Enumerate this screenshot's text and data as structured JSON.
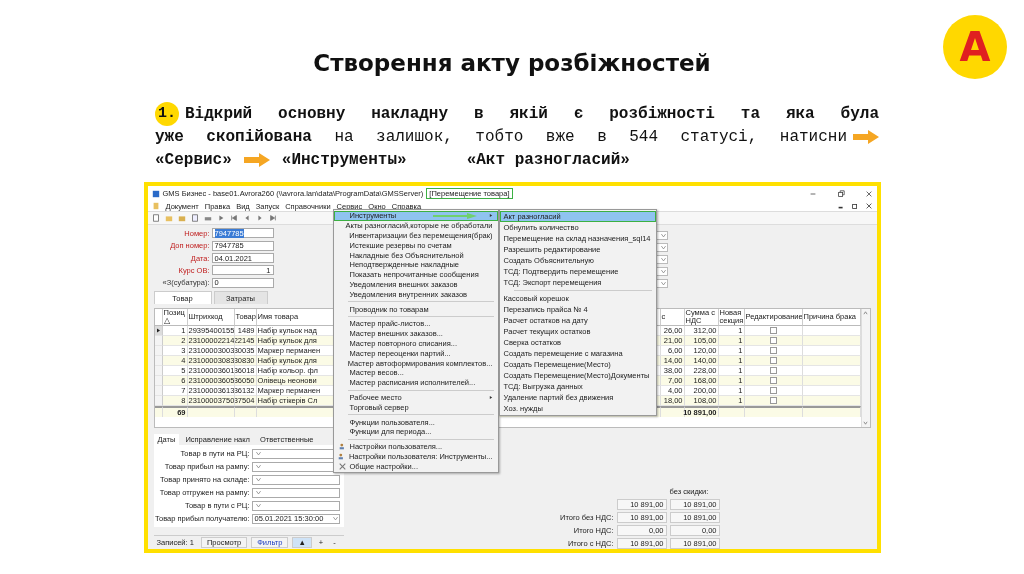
{
  "slide": {
    "title": "Створення акту розбіжностей",
    "badge": "A",
    "step": {
      "number": "1.",
      "lines": [
        {
          "text": "Відкрий основну накладну в якій є розбіжності та яка була",
          "bold": true
        },
        {
          "text": "**уже скопійована** на залишок, тобто вже в 544 статусі,  натисни",
          "bold": false
        }
      ],
      "path": [
        "«Сервис»",
        "«Инструменты»",
        "«Акт разногласий»"
      ]
    }
  },
  "window": {
    "title": "GMS Бизнес - base01.Avrora260 (\\\\avrora.lan\\data\\ProgramData\\GMSServer)",
    "document": "[Перемещение товара]",
    "menu": [
      "Документ",
      "Правка",
      "Вид",
      "Запуск",
      "Справочники",
      "Сервис",
      "Окно",
      "Справка"
    ],
    "fields": [
      {
        "label": "Номер:",
        "value": "7947785",
        "selected": true
      },
      {
        "label": "Доп номер:",
        "value": "7947785",
        "selected": false
      },
      {
        "label": "Дата:",
        "value": "04.01.2021",
        "selected": false
      },
      {
        "label": "Курс ОВ:",
        "value": "1",
        "selected": false
      },
      {
        "label": "«З(субатура):",
        "value": "0",
        "selected": false
      }
    ],
    "tabs": [
      {
        "label": "Товар",
        "selected": true
      },
      {
        "label": "Затраты",
        "selected": false
      }
    ],
    "table": {
      "columns": [
        "Позиц △",
        "Штрихкод",
        "Товар",
        "Имя товара",
        "с",
        "Сумма с НДС",
        "Новая секция",
        "Редактирование",
        "Причина брака"
      ],
      "rows": [
        {
          "selected": true,
          "cells": [
            "1",
            "29395400155",
            "1489",
            "Набір кульок над",
            "26,00",
            "312,00",
            "1"
          ],
          "editing": false
        },
        {
          "selected": false,
          "cells": [
            "2",
            "23100002214",
            "22145",
            "Набір кульок для",
            "21,00",
            "105,00",
            "1"
          ],
          "editing": false
        },
        {
          "selected": false,
          "cells": [
            "3",
            "23100003003",
            "30035",
            "Маркер перманен",
            "6,00",
            "120,00",
            "1"
          ],
          "editing": false
        },
        {
          "selected": false,
          "cells": [
            "4",
            "23100003083",
            "30830",
            "Набір кульок для",
            "14,00",
            "140,00",
            "1"
          ],
          "editing": false
        },
        {
          "selected": false,
          "cells": [
            "5",
            "23100003601",
            "36018",
            "Набір кольор. фл",
            "38,00",
            "228,00",
            "1"
          ],
          "editing": false
        },
        {
          "selected": false,
          "cells": [
            "6",
            "23100003605",
            "36050",
            "Олівець неонови",
            "7,00",
            "168,00",
            "1"
          ],
          "editing": false
        },
        {
          "selected": false,
          "cells": [
            "7",
            "23100003613",
            "36132",
            "Маркер перманен",
            "4,00",
            "200,00",
            "1"
          ],
          "editing": false
        },
        {
          "selected": false,
          "cells": [
            "8",
            "23100003750",
            "37504",
            "Набір стікерів Сл",
            "18,00",
            "108,00",
            "1"
          ],
          "editing": false
        }
      ],
      "total": {
        "count": "69",
        "sum": "10 891,00"
      }
    },
    "bottom_tabs": [
      {
        "label": "Даты",
        "selected": true
      },
      {
        "label": "Исправление накл",
        "selected": false
      },
      {
        "label": "Ответственные",
        "selected": false
      }
    ],
    "dates": [
      {
        "label": "Товар в пути на РЦ:"
      },
      {
        "label": "Товар прибыл на рампу:"
      },
      {
        "label": "Товар принято на складе:"
      },
      {
        "label": "Товар отгружен на рампу:"
      },
      {
        "label": "Товар в пути с РЦ:"
      },
      {
        "label": "Товар прибыл получателю:",
        "value": "05.01.2021 15:30:00"
      }
    ],
    "totals": {
      "header": "без скидки:",
      "rows": [
        {
          "values": [
            "10 891,00",
            "10 891,00"
          ]
        },
        {
          "label": "Итого без НДС:",
          "values": [
            "10 891,00",
            "10 891,00"
          ]
        },
        {
          "label": "Итого НДС:",
          "values": [
            "0,00",
            "0,00"
          ]
        },
        {
          "label": "Итого с НДС:",
          "values": [
            "10 891,00",
            "10 891,00"
          ]
        }
      ]
    },
    "status_bar": {
      "records": "Записей: 1",
      "buttons": [
        "Просмотр",
        "Фильтр"
      ],
      "up": "▲",
      "add": "+",
      "remove": "-"
    }
  },
  "menus": [
    {
      "items": [
        {
          "kind": "item",
          "label": "Инструменты",
          "selected": true,
          "submenu": true
        },
        {
          "kind": "item",
          "label": "Акты разногласий,которые не обработали",
          "selected": false
        },
        {
          "kind": "item",
          "label": "Инвентаризации без перемещения(брак)",
          "selected": false
        },
        {
          "kind": "item",
          "label": "Истекшие резервы по счетам",
          "selected": false
        },
        {
          "kind": "item",
          "label": "Накладные без Объяснительной",
          "selected": false
        },
        {
          "kind": "item",
          "label": "Неподтвержденные накладные",
          "selected": false
        },
        {
          "kind": "item",
          "label": "Показать непрочитанные сообщения",
          "selected": false
        },
        {
          "kind": "item",
          "label": "Уведомления внешних заказов",
          "selected": false
        },
        {
          "kind": "item",
          "label": "Уведомления внутренних заказов",
          "selected": false
        },
        {
          "kind": "separator"
        },
        {
          "kind": "item",
          "label": "Проводник по товарам",
          "selected": false
        },
        {
          "kind": "separator"
        },
        {
          "kind": "item",
          "label": "Мастер прайс-листов...",
          "selected": false
        },
        {
          "kind": "item",
          "label": "Мастер внешних заказов...",
          "selected": false
        },
        {
          "kind": "item",
          "label": "Мастер повторного списания...",
          "selected": false
        },
        {
          "kind": "item",
          "label": "Мастер переоценки партий...",
          "selected": false
        },
        {
          "kind": "item",
          "label": "Мастер автоформирования комплектов...",
          "selected": false
        },
        {
          "kind": "item",
          "label": "Мастер весов...",
          "selected": false
        },
        {
          "kind": "item",
          "label": "Мастер расписания исполнителей...",
          "selected": false
        },
        {
          "kind": "separator"
        },
        {
          "kind": "item",
          "label": "Рабочее место",
          "selected": false,
          "submenu": true
        },
        {
          "kind": "item",
          "label": "Торговый сервер",
          "selected": false
        },
        {
          "kind": "separator"
        },
        {
          "kind": "item",
          "label": "Функции пользователя...",
          "selected": false
        },
        {
          "kind": "item",
          "label": "Функции для периода...",
          "selected": false
        },
        {
          "kind": "separator"
        },
        {
          "kind": "setting",
          "label": "Настройки пользователя...",
          "selected": false
        },
        {
          "kind": "setting",
          "label": "Настройки пользователя: Инструменты...",
          "selected": false
        },
        {
          "kind": "tools",
          "label": "Общие настройки...",
          "selected": false
        }
      ]
    },
    {
      "items": [
        {
          "kind": "item",
          "label": "Акт разногласий",
          "selected": true
        },
        {
          "kind": "item",
          "label": "Обнулить количество",
          "selected": false
        },
        {
          "kind": "item",
          "label": "Перемещение на склад назначения_sql14",
          "selected": false
        },
        {
          "kind": "item",
          "label": "Разрешить редактирование",
          "selected": false
        },
        {
          "kind": "item",
          "label": "Создать Объяснительную",
          "selected": false
        },
        {
          "kind": "item",
          "label": "ТСД: Подтвердить перемещение",
          "selected": false
        },
        {
          "kind": "item",
          "label": "ТСД: Экспорт перемещения",
          "selected": false
        },
        {
          "kind": "separator"
        },
        {
          "kind": "item",
          "label": "Кассовый корешок",
          "selected": false
        },
        {
          "kind": "item",
          "label": "Перезапись прайса № 4",
          "selected": false
        },
        {
          "kind": "item",
          "label": "Расчет остатков на дату",
          "selected": false
        },
        {
          "kind": "item",
          "label": "Расчет текущих остатков",
          "selected": false
        },
        {
          "kind": "item",
          "label": "Сверка остатков",
          "selected": false
        },
        {
          "kind": "item",
          "label": "Создать перемещение с магазина",
          "selected": false
        },
        {
          "kind": "item",
          "label": "Создать Перемещение(Место)",
          "selected": false
        },
        {
          "kind": "item",
          "label": "Создать Перемещение(Место)Документы",
          "selected": false
        },
        {
          "kind": "item",
          "label": "ТСД: Выгрузка данных",
          "selected": false
        },
        {
          "kind": "item",
          "label": "Удаление партий без движения",
          "selected": false
        },
        {
          "kind": "item",
          "label": "Хоз. нужды",
          "selected": false
        }
      ]
    }
  ]
}
